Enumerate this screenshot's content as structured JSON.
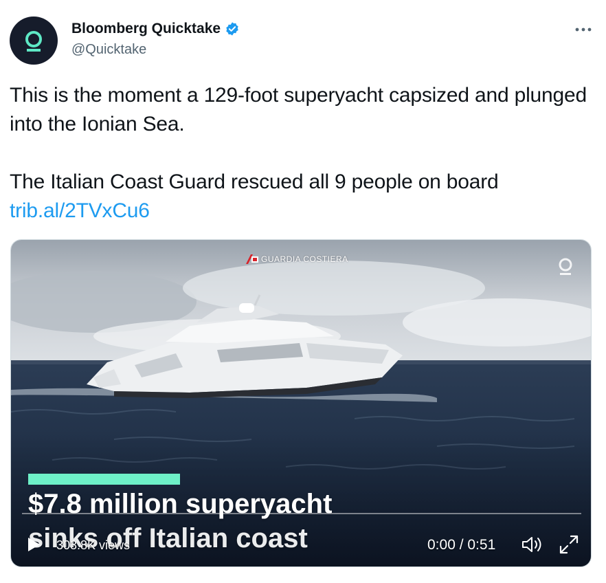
{
  "tweet": {
    "author": {
      "name": "Bloomberg Quicktake",
      "handle": "@Quicktake",
      "verified": true,
      "avatar_icon": "quicktake-logo-icon",
      "avatar_bg": "#161c2b",
      "accent": "#5ee8c5"
    },
    "more_icon": "more-dots-icon",
    "text": {
      "line1": "This is the moment a 129-foot superyacht capsized and plunged into the Ionian Sea.",
      "line2": "The Italian Coast Guard rescued all 9 people on board",
      "link": "trib.al/2TVxCu6"
    },
    "link_color": "#1d9bf0",
    "verified_color": "#1d9bf0"
  },
  "media": {
    "watermark": "GUARDIA COSTIERA",
    "caption_line1": "$7.8 million superyacht",
    "caption_line2": "sinks off Italian coast",
    "caption_accent": "#6ef0c7",
    "video": {
      "views": "303.8K views",
      "time": "0:00 / 0:51",
      "progress": 0,
      "play_icon": "play-icon",
      "volume_icon": "volume-icon",
      "fullscreen_icon": "fullscreen-icon"
    }
  }
}
